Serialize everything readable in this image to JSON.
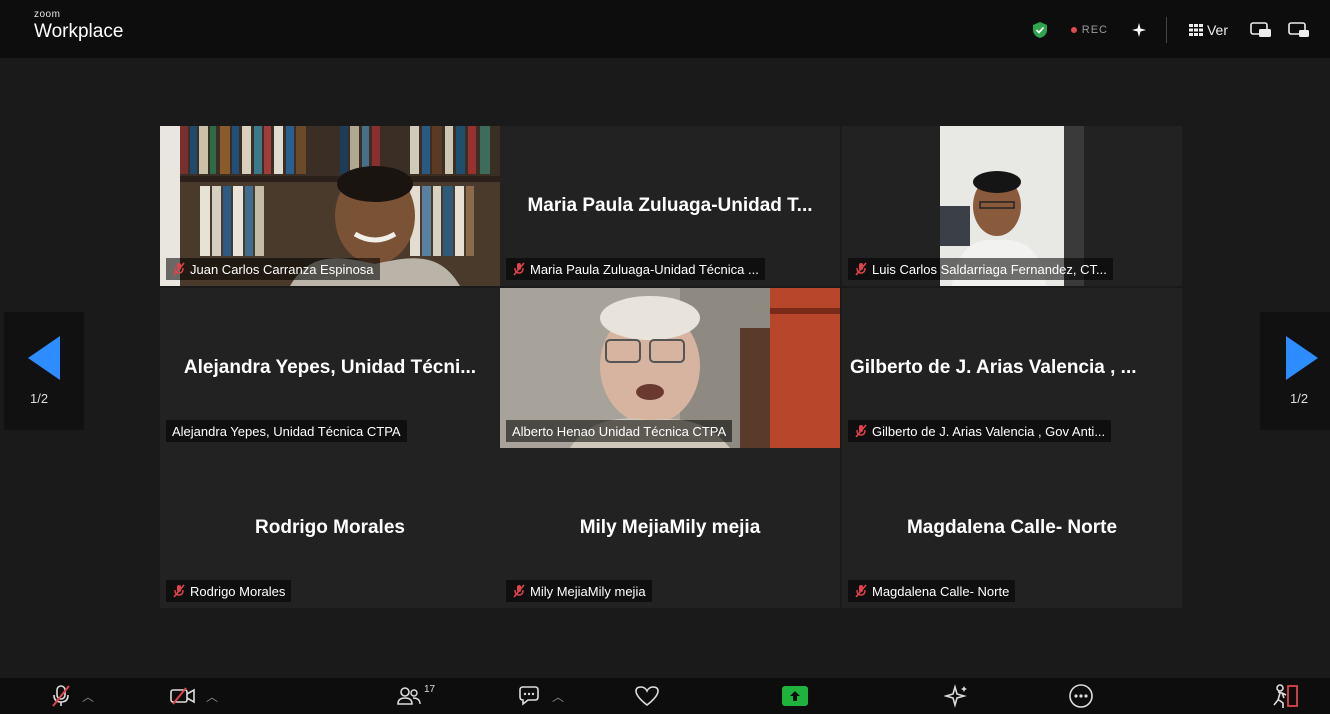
{
  "app": {
    "brand_small": "zoom",
    "brand_big": "Workplace"
  },
  "topbar": {
    "rec_label": "REC",
    "view_label": "Ver",
    "colors": {
      "shield": "#2ea44f",
      "rec_dot": "#e5484d"
    }
  },
  "participants": [
    {
      "tile_name": "",
      "label": "Juan Carlos Carranza Espinosa",
      "muted": true,
      "video": "bookshelf-man"
    },
    {
      "tile_name": "Maria Paula Zuluaga-Unidad T...",
      "label": "Maria Paula Zuluaga-Unidad Técnica ...",
      "muted": true
    },
    {
      "tile_name": "",
      "label": "Luis Carlos Saldarriaga Fernandez, CT...",
      "muted": true,
      "video": "office-man"
    },
    {
      "tile_name": "Alejandra Yepes, Unidad Técni...",
      "label": "Alejandra Yepes, Unidad Técnica CTPA",
      "muted": false
    },
    {
      "tile_name": "",
      "label": "Alberto Henao Unidad Técnica CTPA",
      "muted": false,
      "video": "elderly-man",
      "active_speaker": true
    },
    {
      "tile_name": "Gilberto de J. Arias Valencia , ...",
      "label": "Gilberto de J. Arias Valencia , Gov Anti...",
      "muted": true
    },
    {
      "tile_name": "Rodrigo Morales",
      "label": "Rodrigo Morales",
      "muted": true
    },
    {
      "tile_name": "Mily MejiaMily mejia",
      "label": "Mily MejiaMily mejia",
      "muted": true
    },
    {
      "tile_name": "Magdalena Calle- Norte",
      "label": "Magdalena Calle- Norte",
      "muted": true
    }
  ],
  "pagination": {
    "left": "1/2",
    "right": "1/2",
    "arrow_color": "#2d8cff"
  },
  "bottombar": {
    "participants_count": "17",
    "share_color": "#1db33c"
  }
}
